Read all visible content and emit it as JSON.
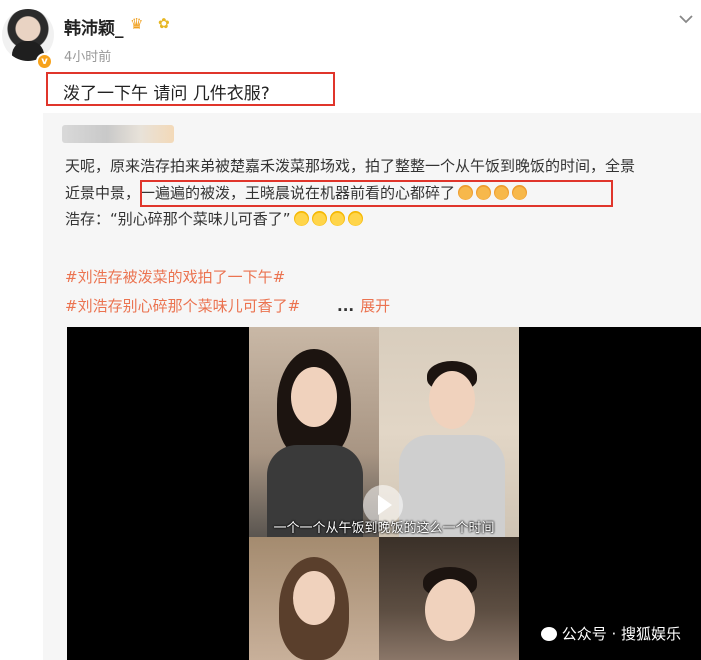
{
  "post": {
    "username": "韩沛颖_",
    "time": "4小时前",
    "caption": "泼了一下午 请问 几件衣服?"
  },
  "repost": {
    "line1": "天呢，原来浩存拍来弟被楚嘉禾泼菜那场戏，拍了整整一个从午饭到晚饭的时间，全景",
    "line2": "近景中景，一遍遍的被泼，王晓晨说在机器前看的心都碎了",
    "line3": "浩存：“别心碎那个菜味儿可香了”",
    "tags": [
      "#刘浩存被泼菜的戏拍了一下午#",
      "#刘浩存别心碎那个菜味儿可香了#"
    ],
    "more_dots": "...",
    "expand": "展开"
  },
  "video": {
    "subtitle": "一个一个从午饭到晚饭的这么一个时间"
  },
  "watermark": "公众号 · 搜狐娱乐",
  "colors": {
    "highlight_box": "#e0352b",
    "tag_link": "#eb7350",
    "verified_badge": "#f7a21b"
  },
  "icons": [
    "verified-badge-icon",
    "crown-icon",
    "flower-icon",
    "chevron-down-icon",
    "play-icon",
    "wechat-icon"
  ]
}
